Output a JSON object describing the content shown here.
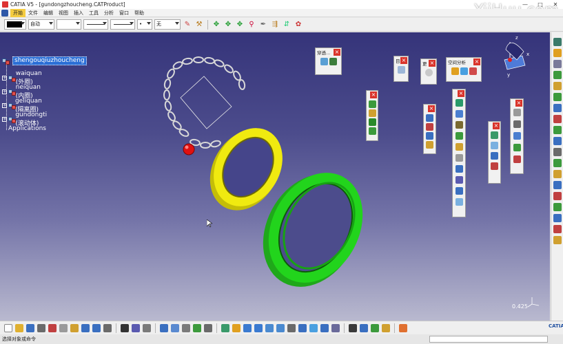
{
  "window": {
    "title": "CATIA V5 - [gundongzhoucheng.CATProduct]",
    "minimize": "—",
    "maximize": "□",
    "close": "✕"
  },
  "watermark": "YiiHuu.com",
  "menu": {
    "items": [
      "开始",
      "文件",
      "编辑",
      "视图",
      "插入",
      "工具",
      "分析",
      "窗口",
      "帮助"
    ]
  },
  "format_toolbar": {
    "layer_value": "自动",
    "line_type_value": "",
    "line_weight_value": "",
    "point_value": "•",
    "no_filter_value": "无",
    "fill_color": "#000000"
  },
  "spec_tree": {
    "root": "shengouqiuzhoucheng",
    "nodes": [
      "waiquan (外圈)",
      "neiquan (内圈)",
      "geliquan (隔离圈)",
      "gundongti (滚动体)"
    ],
    "applications": "Applications"
  },
  "floating_toolbars": {
    "tb1_title": "穿透...",
    "tb2_title": "目",
    "tb3_title": "更",
    "tb4_title": "空间分析",
    "tb5_title": "",
    "tb6_title": "",
    "tb7_title": "",
    "tb8_title": "",
    "tb9_title": "",
    "close_glyph": "×"
  },
  "viewport": {
    "zoom_readout": "0.425"
  },
  "status": {
    "text": "选择对象或命令",
    "logo": "CATIA"
  },
  "colors": {
    "outer_ring": "#22d41c",
    "inner_ring": "#f0ea10",
    "cage": "#d8d8d8",
    "ball": "#e01010",
    "selection_highlight": "#2b6fd6"
  }
}
